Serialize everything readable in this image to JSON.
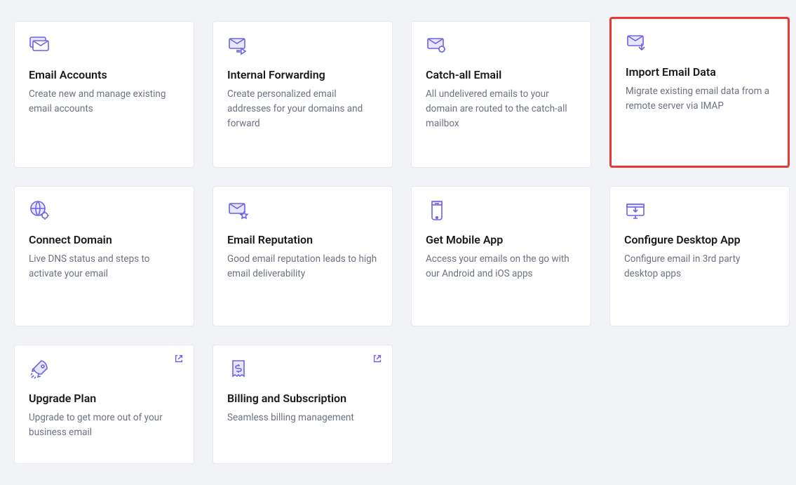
{
  "cards": [
    {
      "title": "Email Accounts",
      "desc": "Create new and manage existing email accounts"
    },
    {
      "title": "Internal Forwarding",
      "desc": "Create personalized email addresses for your domains and forward"
    },
    {
      "title": "Catch-all Email",
      "desc": "All undelivered emails to your domain are routed to the catch-all mailbox"
    },
    {
      "title": "Import Email Data",
      "desc": "Migrate existing email data from a remote server via IMAP"
    },
    {
      "title": "Connect Domain",
      "desc": "Live DNS status and steps to activate your email"
    },
    {
      "title": "Email Reputation",
      "desc": "Good email reputation leads to high email deliverability"
    },
    {
      "title": "Get Mobile App",
      "desc": "Access your emails on the go with our Android and iOS apps"
    },
    {
      "title": "Configure Desktop App",
      "desc": "Configure email in 3rd party desktop apps"
    },
    {
      "title": "Upgrade Plan",
      "desc": "Upgrade to get more out of your business email"
    },
    {
      "title": "Billing and Subscription",
      "desc": "Seamless billing management"
    }
  ]
}
